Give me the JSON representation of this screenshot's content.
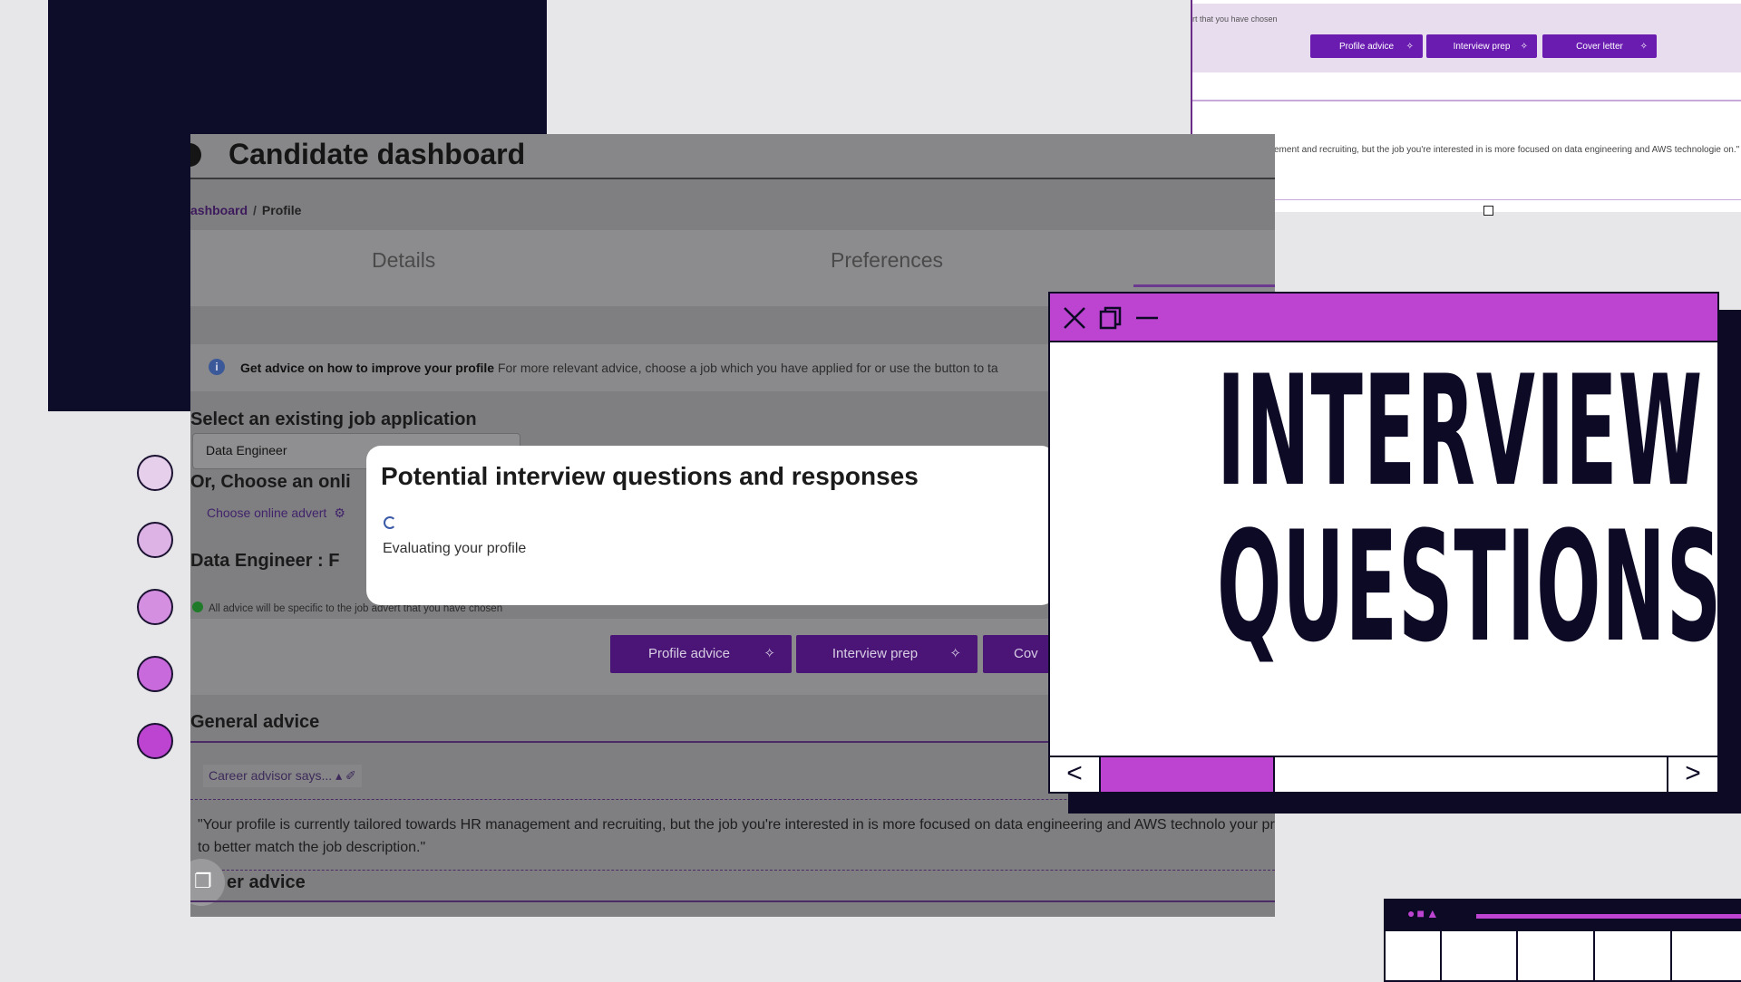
{
  "dashboard": {
    "title": "Candidate dashboard",
    "breadcrumb": {
      "parent": "ashboard",
      "separator": "/",
      "current": "Profile"
    },
    "tabs": [
      "Details",
      "Preferences"
    ],
    "info": {
      "bold": "Get advice on how to improve your profile",
      "rest": " For more relevant advice, choose a job which you have applied for or use the button to ta"
    },
    "select_heading": "Select an existing job application",
    "selected_job": "Data Engineer",
    "choose_heading": "Or, Choose an onli",
    "choose_advert": "Choose online advert",
    "job_heading": "Data Engineer : F",
    "specific_note": "All advice will be specific to the job advert that you have chosen",
    "buttons": [
      "Profile advice",
      "Interview prep",
      "Cov"
    ],
    "general_advice": "General advice",
    "career_says": "Career advisor says...",
    "quote": "\"Your profile is currently tailored towards HR management and recruiting, but the job you're interested in is more focused on data engineering and AWS technolo your profile to better match the job description.\"",
    "other_advice": "er advice"
  },
  "modal": {
    "title": "Potential interview questions and responses",
    "status": "Evaluating your profile"
  },
  "top_right": {
    "note": "rt that you have chosen",
    "buttons": [
      "Profile advice",
      "Interview prep",
      "Cover letter"
    ],
    "quote": "ement and recruiting, but the job you're interested in is more focused on data engineering and AWS technologie on.\""
  },
  "window": {
    "line1": "INTERVIEW",
    "line2": "QUESTIONS",
    "nav_prev": "<",
    "nav_next": ">"
  },
  "colors": {
    "accent": "#bd43d1",
    "navy": "#0d0a26",
    "button_purple": "#4a1577"
  },
  "dots": [
    "#e6cfea",
    "#ddb3e6",
    "#d48fe1",
    "#c869dc",
    "#bd43d1"
  ]
}
